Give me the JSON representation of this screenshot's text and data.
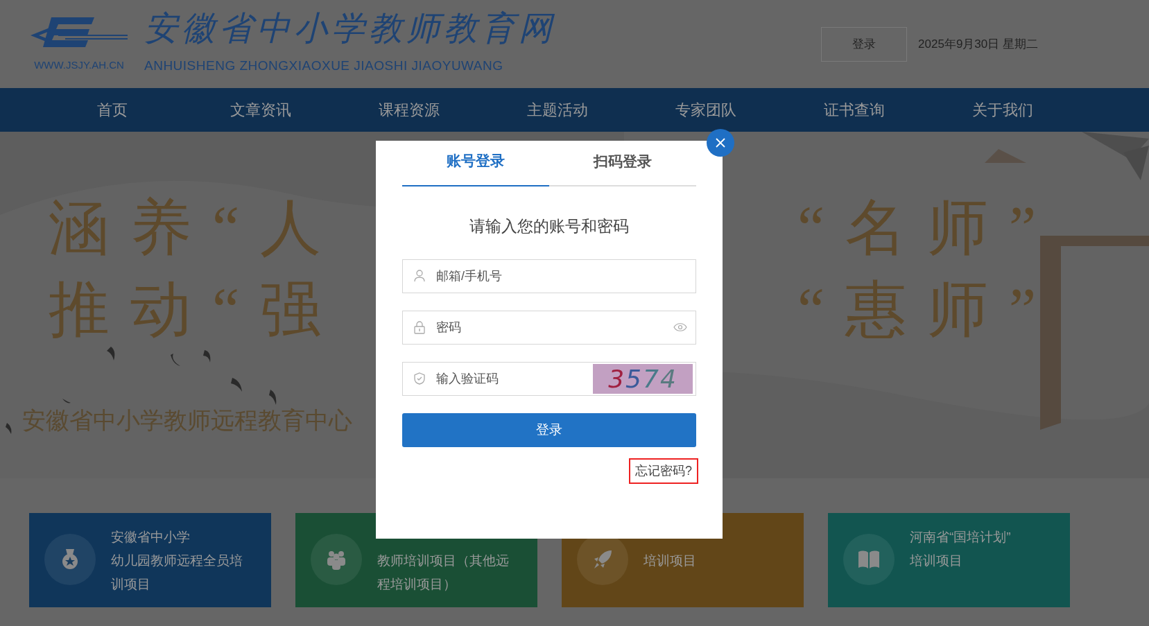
{
  "header": {
    "logo": {
      "url": "WWW.JSJY.AH.CN",
      "title": "安徽省中小学教师教育网",
      "subtitle": "ANHUISHENG ZHONGXIAOXUE JIAOSHI JIAOYUWANG"
    },
    "login_button": "登录",
    "date": "2025年9月30日 星期二"
  },
  "nav": [
    {
      "label": "首页"
    },
    {
      "label": "文章资讯"
    },
    {
      "label": "课程资源"
    },
    {
      "label": "主题活动"
    },
    {
      "label": "专家团队"
    },
    {
      "label": "证书查询"
    },
    {
      "label": "关于我们"
    }
  ],
  "banner": {
    "rows": [
      {
        "left": "涵养“人",
        "right": "“名师”"
      },
      {
        "left": "推动“强",
        "right": "“惠师”"
      }
    ],
    "caption": "安徽省中小学教师远程教育中心"
  },
  "cards": [
    {
      "color": "#10365a",
      "lines": [
        "安徽省中小学",
        "幼儿园教师远程全员培",
        "训项目"
      ]
    },
    {
      "color": "#1a4f35",
      "lines": [
        "教师培训项目（其他远",
        "程培训项目）"
      ]
    },
    {
      "color": "#624618",
      "lines": [
        "培训项目"
      ]
    },
    {
      "color": "#125550",
      "lines": [
        "河南省“国培计划”",
        "培训项目"
      ]
    }
  ],
  "modal": {
    "tabs": [
      {
        "label": "账号登录",
        "selected": true
      },
      {
        "label": "扫码登录",
        "selected": false
      }
    ],
    "heading": "请输入您的账号和密码",
    "fields": [
      {
        "kind": "user",
        "placeholder": "邮箱/手机号"
      },
      {
        "kind": "password",
        "placeholder": "密码"
      },
      {
        "kind": "captcha",
        "placeholder": "输入验证码",
        "captcha": "3574"
      }
    ],
    "submit": "登录",
    "forgot": {
      "label": "忘记密码?",
      "highlighted": true
    }
  }
}
